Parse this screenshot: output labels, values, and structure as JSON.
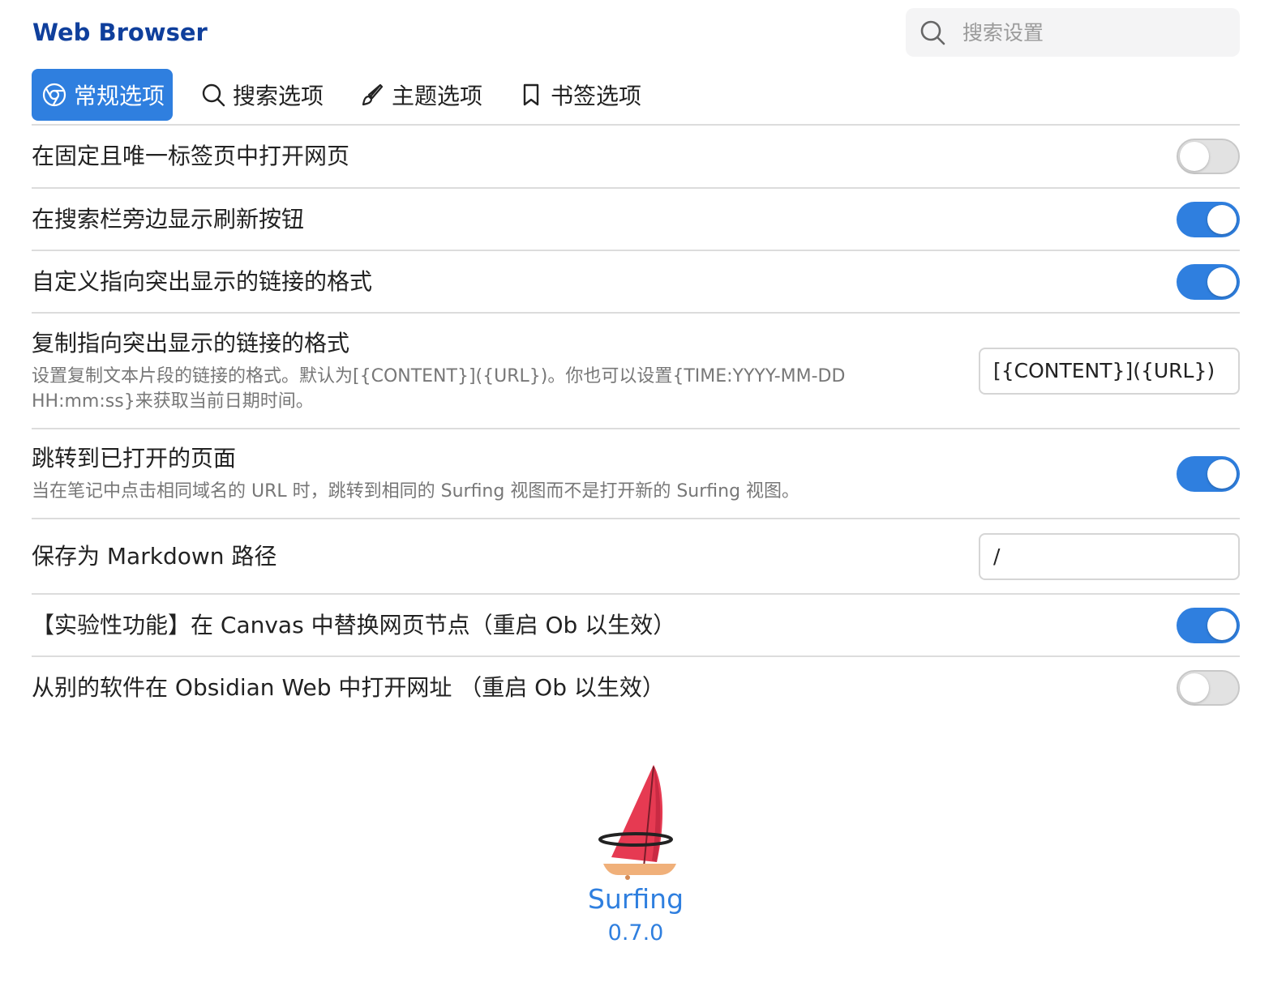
{
  "app": {
    "title": "Web Browser"
  },
  "search": {
    "placeholder": "搜索设置"
  },
  "tabs": [
    {
      "label": "常规选项",
      "icon": "chrome-icon",
      "active": true
    },
    {
      "label": "搜索选项",
      "icon": "search-icon",
      "active": false
    },
    {
      "label": "主题选项",
      "icon": "brush-icon",
      "active": false
    },
    {
      "label": "书签选项",
      "icon": "bookmark-icon",
      "active": false
    }
  ],
  "settings": [
    {
      "name": "在固定且唯一标签页中打开网页",
      "control": "toggle",
      "enabled": false
    },
    {
      "name": "在搜索栏旁边显示刷新按钮",
      "control": "toggle",
      "enabled": true
    },
    {
      "name": "自定义指向突出显示的链接的格式",
      "control": "toggle",
      "enabled": true
    },
    {
      "name": "复制指向突出显示的链接的格式",
      "desc": "设置复制文本片段的链接的格式。默认为[{CONTENT}]({URL})。你也可以设置{TIME:YYYY-MM-DD HH:mm:ss}来获取当前日期时间。",
      "control": "text",
      "value": "[{CONTENT}]({URL})"
    },
    {
      "name": "跳转到已打开的页面",
      "desc": "当在笔记中点击相同域名的 URL 时，跳转到相同的 Surfing 视图而不是打开新的 Surfing 视图。",
      "control": "toggle",
      "enabled": true
    },
    {
      "name": "保存为 Markdown 路径",
      "control": "text",
      "value": "/"
    },
    {
      "name": "【实验性功能】在 Canvas 中替换网页节点（重启 Ob 以生效）",
      "control": "toggle",
      "enabled": true
    },
    {
      "name": "从别的软件在 Obsidian Web 中打开网址 （重启 Ob 以生效）",
      "control": "toggle",
      "enabled": false
    }
  ],
  "footer": {
    "plugin_name": "Surfing",
    "version": "0.7.0",
    "logo_icon": "windsurf-sail-icon"
  },
  "colors": {
    "accent": "#2f7fdf",
    "title": "#0f3f9c",
    "sail": "#e63a52",
    "board": "#f0b07a"
  }
}
